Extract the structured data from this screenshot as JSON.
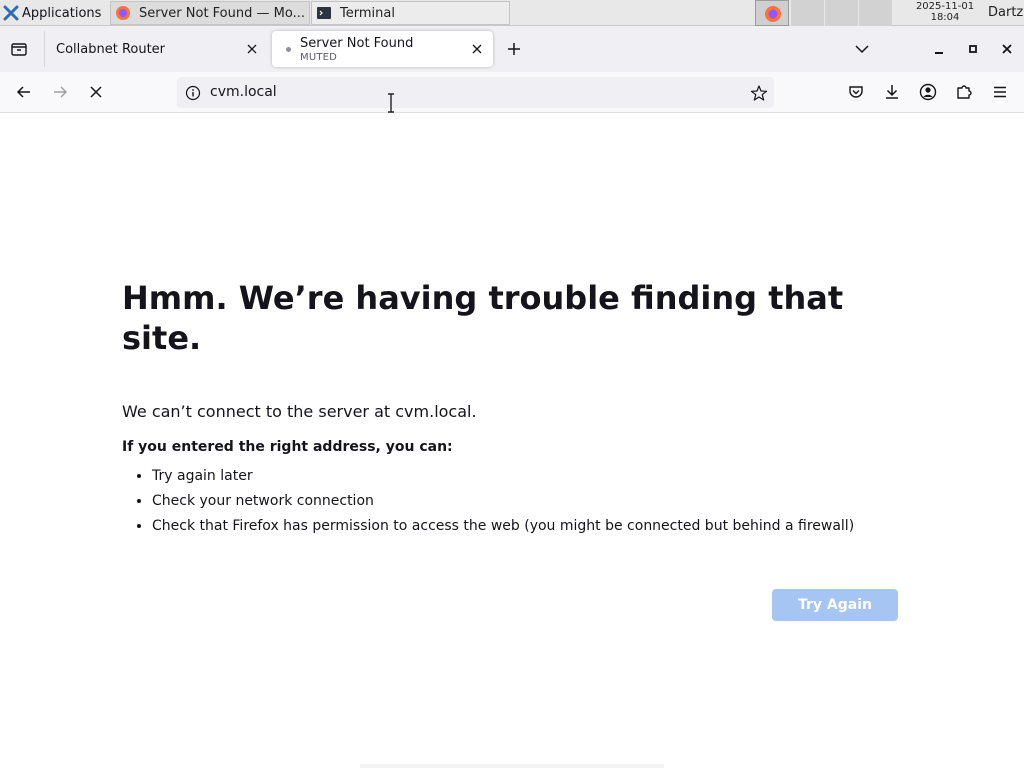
{
  "taskbar": {
    "apps_label": "Applications",
    "tasks": [
      {
        "label": "Server Not Found — Mo..."
      },
      {
        "label": "Terminal"
      }
    ],
    "clock_date": "2025-11-01",
    "clock_time": "18:04",
    "user": "Dartz"
  },
  "tabs": [
    {
      "title": "Collabnet Router"
    },
    {
      "title": "Server Not Found",
      "subtitle": "MUTED"
    }
  ],
  "urlbar": {
    "url": "cvm.local"
  },
  "page": {
    "heading": "Hmm. We’re having trouble finding that site.",
    "description": "We can’t connect to the server at cvm.local.",
    "bold_line": "If you entered the right address, you can:",
    "bullets": [
      "Try again later",
      "Check your network connection",
      "Check that Firefox has permission to access the web (you might be connected but behind a firewall)"
    ],
    "try_again_label": "Try Again"
  },
  "colors": {
    "accent_button": "#a7c5f2",
    "tab_strip": "#f0f0f4",
    "text": "#15141a"
  },
  "icons": [
    "xfce-logo-icon",
    "firefox-icon",
    "terminal-icon",
    "tab-list-icon",
    "close-icon",
    "plus-icon",
    "chevron-down-icon",
    "minimize-icon",
    "maximize-icon",
    "back-arrow-icon",
    "forward-arrow-icon",
    "stop-icon",
    "info-icon",
    "star-icon",
    "pocket-icon",
    "download-icon",
    "account-icon",
    "extensions-icon",
    "hamburger-menu-icon",
    "text-cursor-icon"
  ]
}
